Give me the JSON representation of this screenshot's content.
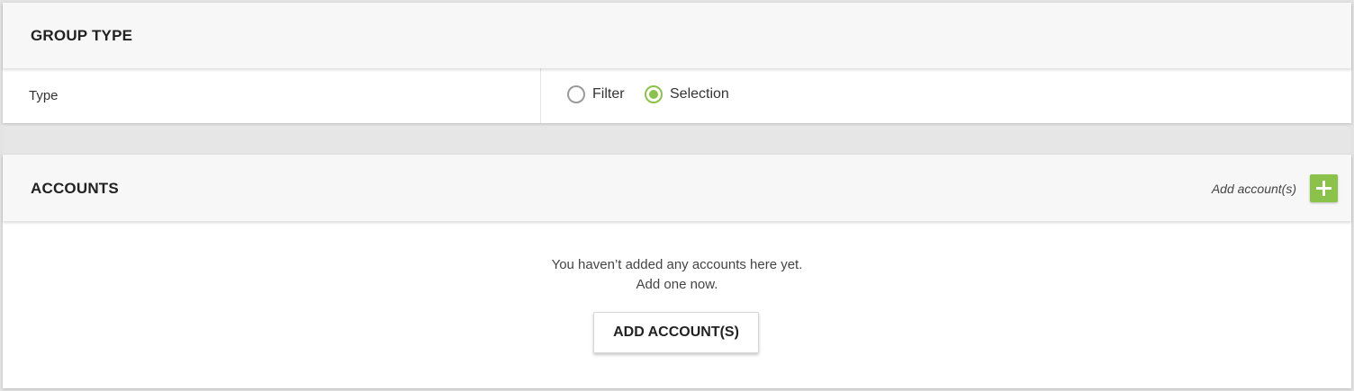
{
  "group_type": {
    "title": "GROUP TYPE",
    "type_label": "Type",
    "options": [
      {
        "label": "Filter",
        "checked": false
      },
      {
        "label": "Selection",
        "checked": true
      }
    ]
  },
  "accounts": {
    "title": "ACCOUNTS",
    "add_link_label": "Add account(s)",
    "add_icon": "plus-icon",
    "empty_line1": "You haven’t added any accounts here yet.",
    "empty_line2": "Add one now.",
    "add_button_label": "ADD ACCOUNT(S)"
  },
  "colors": {
    "accent": "#8bc34a",
    "header_bg": "#f7f7f7",
    "page_bg": "#e6e6e6"
  }
}
